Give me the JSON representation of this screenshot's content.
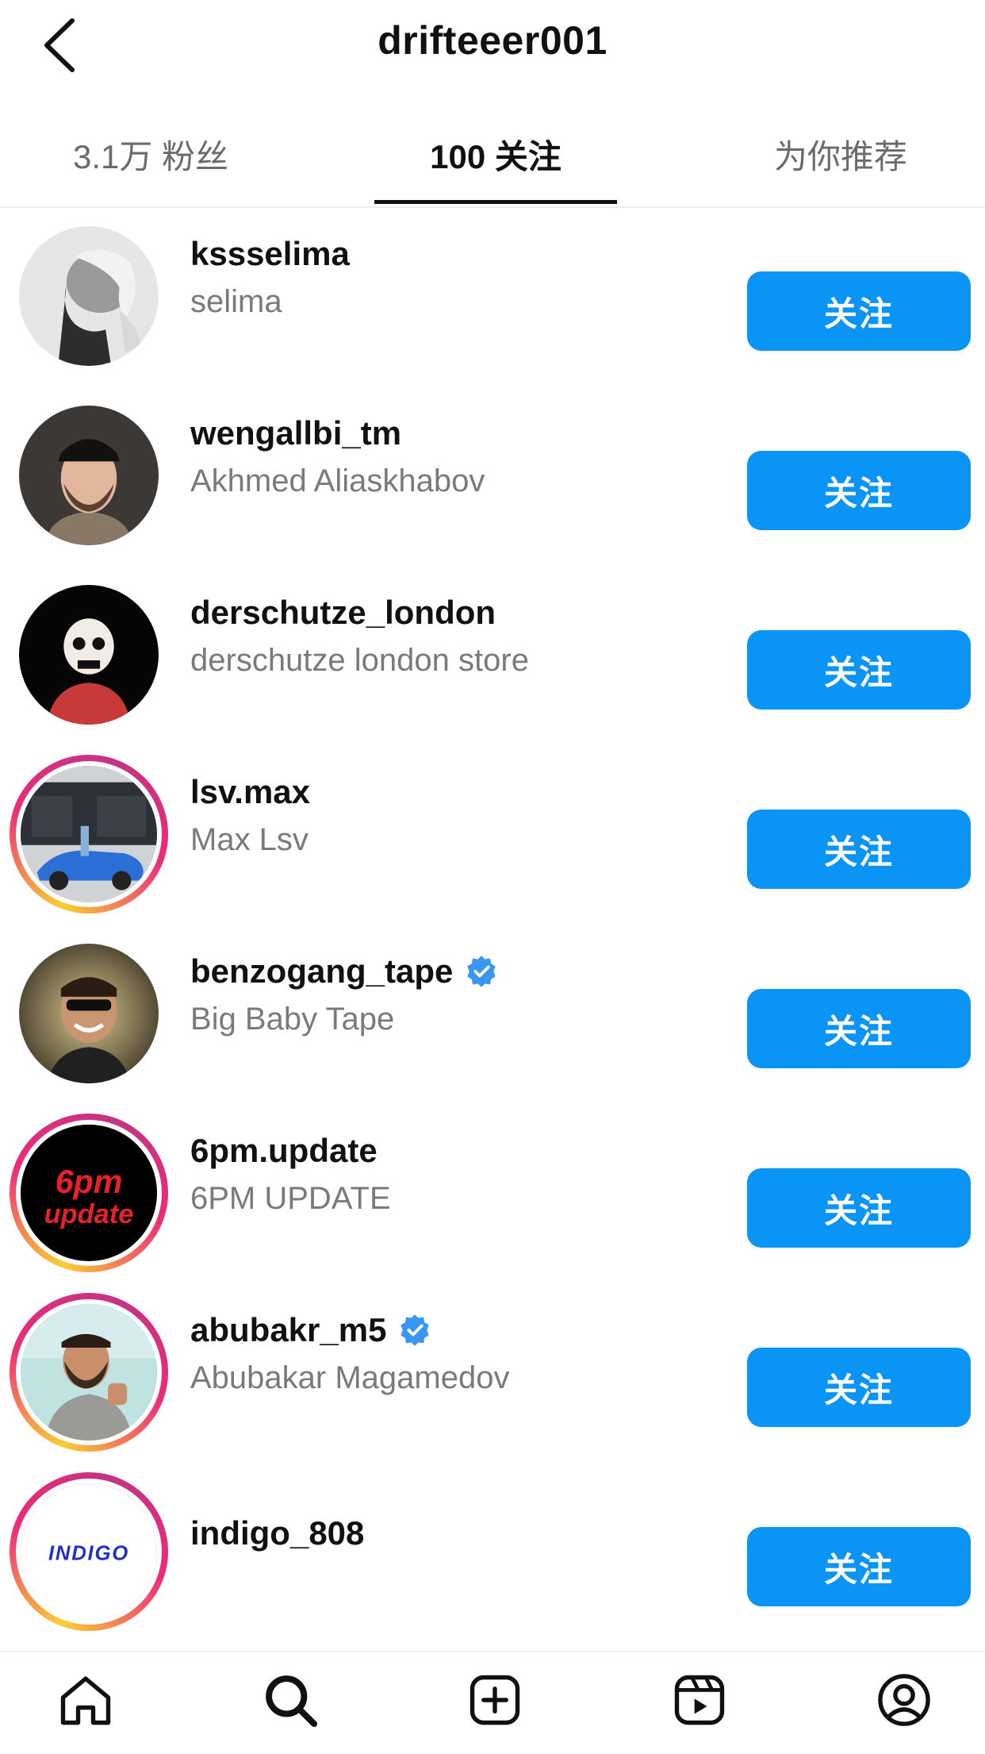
{
  "header": {
    "title": "drifteeer001"
  },
  "tabs": [
    {
      "label": "3.1万 粉丝"
    },
    {
      "label": "100 关注"
    },
    {
      "label": "为你推荐"
    }
  ],
  "follow_label": "关注",
  "users": [
    {
      "username": "kssselima",
      "fullname": "selima",
      "verified": false,
      "story_ring": false
    },
    {
      "username": "wengallbi_tm",
      "fullname": "Akhmed Aliaskhabov",
      "verified": false,
      "story_ring": false
    },
    {
      "username": "derschutze_london",
      "fullname": "derschutze london store",
      "verified": false,
      "story_ring": false
    },
    {
      "username": "lsv.max",
      "fullname": "Max Lsv",
      "verified": false,
      "story_ring": true
    },
    {
      "username": "benzogang_tape",
      "fullname": "Big Baby Tape",
      "verified": true,
      "story_ring": false
    },
    {
      "username": "6pm.update",
      "fullname": "6PM UPDATE",
      "verified": false,
      "story_ring": true
    },
    {
      "username": "abubakr_m5",
      "fullname": "Abubakar Magamedov",
      "verified": true,
      "story_ring": true
    },
    {
      "username": "indigo_808",
      "fullname": "",
      "verified": false,
      "story_ring": true
    }
  ],
  "avatar_text": {
    "sixpm_top": "6pm",
    "sixpm_bottom": "update",
    "indigo": "INDIGO"
  },
  "colors": {
    "accent": "#0a95f6",
    "verified": "#3897f0"
  },
  "bottom_nav": [
    {
      "icon": "home-icon"
    },
    {
      "icon": "search-icon"
    },
    {
      "icon": "create-icon"
    },
    {
      "icon": "reels-icon"
    },
    {
      "icon": "profile-icon"
    }
  ]
}
